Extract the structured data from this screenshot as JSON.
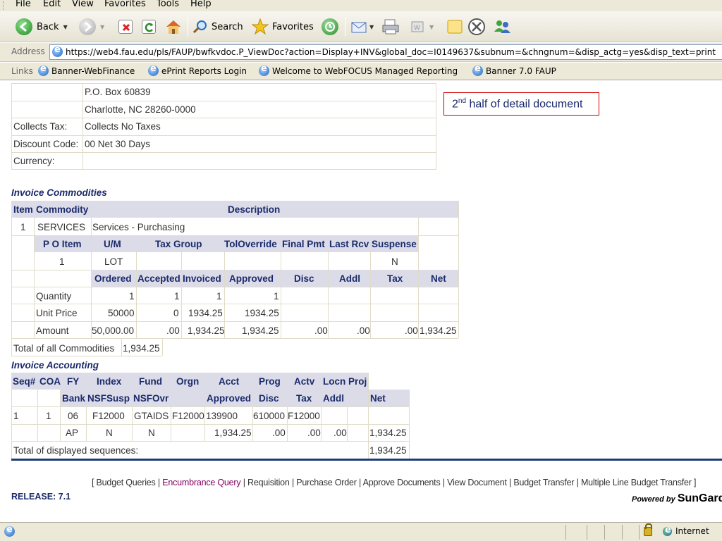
{
  "menu": [
    "File",
    "Edit",
    "View",
    "Favorites",
    "Tools",
    "Help"
  ],
  "toolbar": {
    "back_label": "Back",
    "search_label": "Search",
    "favorites_label": "Favorites"
  },
  "address": {
    "label": "Address",
    "url": "https://web4.fau.edu/pls/FAUP/bwfkvdoc.P_ViewDoc?action=Display+INV&global_doc=I0149637&subnum=&chngnum=&disp_actg=yes&disp_text=print"
  },
  "links": {
    "label": "Links",
    "items": [
      "Banner-WebFinance",
      "ePrint Reports Login",
      "Welcome to WebFOCUS Managed Reporting",
      "Banner 7.0 FAUP"
    ]
  },
  "vendor": {
    "address_line1": "P.O. Box 60839",
    "address_line2": "Charlotte, NC 28260-0000",
    "collects_tax_label": "Collects Tax:",
    "collects_tax_value": "Collects No Taxes",
    "discount_label": "Discount Code:",
    "discount_value": "00 Net 30 Days",
    "currency_label": "Currency:",
    "currency_value": ""
  },
  "callout": {
    "ordinal": "2",
    "suffix": "nd",
    "text": " half of detail document"
  },
  "commodities": {
    "title": "Invoice Commodities",
    "header1": [
      "Item",
      "Commodity",
      "Description"
    ],
    "item": "1",
    "commodity": "SERVICES",
    "description": "Services - Purchasing",
    "header2": [
      "P O Item",
      "U/M",
      "Tax Group",
      "TolOverride",
      "Final Pmt",
      "Last Rcv",
      "Suspense"
    ],
    "po_item": "1",
    "um": "LOT",
    "suspense": "N",
    "header3": [
      "Ordered",
      "Accepted",
      "Invoiced",
      "Approved",
      "Disc",
      "Addl",
      "Tax",
      "Net"
    ],
    "rows": [
      {
        "label": "Quantity",
        "ordered": "1",
        "accepted": "1",
        "invoiced": "1",
        "approved": "1",
        "disc": "",
        "addl": "",
        "tax": "",
        "net": ""
      },
      {
        "label": "Unit Price",
        "ordered": "50000",
        "accepted": "0",
        "invoiced": "1934.25",
        "approved": "1934.25",
        "disc": "",
        "addl": "",
        "tax": "",
        "net": ""
      },
      {
        "label": "Amount",
        "ordered": "50,000.00",
        "accepted": ".00",
        "invoiced": "1,934.25",
        "approved": "1,934.25",
        "disc": ".00",
        "addl": ".00",
        "tax": ".00",
        "net": "1,934.25"
      }
    ],
    "total_label": "Total of all Commodities",
    "total_value": "1,934.25"
  },
  "accounting": {
    "title": "Invoice Accounting",
    "header1": [
      "Seq#",
      "COA",
      "FY",
      "Index",
      "Fund",
      "Orgn",
      "Acct",
      "Prog",
      "Actv",
      "Locn",
      "Proj"
    ],
    "header2": [
      "Bank",
      "NSFSusp",
      "NSFOvr",
      "Approved",
      "Disc",
      "Tax",
      "Addl",
      "Net"
    ],
    "row1": [
      "1",
      "1",
      "06",
      "F12000",
      "GTAIDS",
      "F12000",
      "139900",
      "610000",
      "F12000"
    ],
    "row2": [
      "AP",
      "N",
      "N",
      "1,934.25",
      ".00",
      ".00",
      ".00",
      "1,934.25"
    ],
    "total_label": "Total of displayed sequences:",
    "total_value": "1,934.25"
  },
  "footer": {
    "links": [
      "Budget Queries",
      "Encumbrance Query",
      "Requisition",
      "Purchase Order",
      "Approve Documents",
      "View Document",
      "Budget Transfer",
      "Multiple Line Budget Transfer"
    ],
    "release": "RELEASE: 7.1",
    "powered_by": "Powered by",
    "brand": "SunGard"
  },
  "status": {
    "zone": "Internet"
  }
}
